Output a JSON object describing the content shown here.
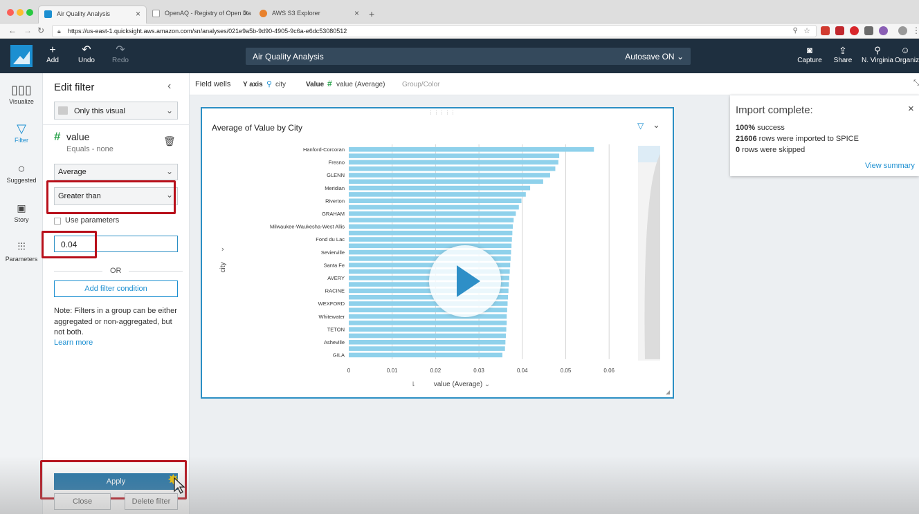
{
  "browser": {
    "tabs": [
      {
        "label": "Air Quality Analysis",
        "active": true
      },
      {
        "label": "OpenAQ - Registry of Open Da",
        "active": false
      },
      {
        "label": "AWS S3 Explorer",
        "active": false
      }
    ],
    "url": "https://us-east-1.quicksight.aws.amazon.com/sn/analyses/021e9a5b-9d90-4905-9c6a-e6dc53080512"
  },
  "header": {
    "add": "Add",
    "undo": "Undo",
    "redo": "Redo",
    "title": "Air Quality Analysis",
    "autosave": "Autosave ON",
    "capture": "Capture",
    "share": "Share",
    "region": "N. Virginia",
    "org": "Organiz"
  },
  "rail": {
    "visualize": "Visualize",
    "filter": "Filter",
    "suggested": "Suggested",
    "story": "Story",
    "parameters": "Parameters"
  },
  "filter_panel": {
    "title": "Edit filter",
    "scope": "Only this visual",
    "field_name": "value",
    "field_desc": "Equals - none",
    "aggregation": "Average",
    "condition": "Greater than",
    "use_parameters": "Use parameters",
    "value": "0.04",
    "or": "OR",
    "add_condition": "Add filter condition",
    "note": "Note: Filters in a group can be either aggregated or non-aggregated, but not both.",
    "learn_more": "Learn more",
    "apply": "Apply",
    "close": "Close",
    "delete": "Delete filter"
  },
  "field_wells": {
    "label": "Field wells",
    "y_axis_label": "Y axis",
    "y_axis_value": "city",
    "value_label": "Value",
    "value_value": "value (Average)",
    "group_label": "Group/Color"
  },
  "toast": {
    "title": "Import complete:",
    "line1_bold": "100%",
    "line1": " success",
    "line2_bold": "21606",
    "line2": " rows were imported to SPICE",
    "line3_bold": "0",
    "line3": " rows were skipped",
    "link": "View summary"
  },
  "colors": {
    "bar": "#8fd1eb",
    "accent": "#1c8fd1",
    "header": "#1e2f3f",
    "highlight": "#b80f1a"
  },
  "chart_data": {
    "type": "bar",
    "orientation": "horizontal",
    "title": "Average of Value by City",
    "xlabel": "value (Average)",
    "ylabel": "city",
    "xlim": [
      0,
      0.06
    ],
    "xticks": [
      "0",
      "0.01",
      "0.02",
      "0.03",
      "0.04",
      "0.05",
      "0.06"
    ],
    "categories": [
      "Hanford-Corcoran",
      "",
      "Fresno",
      "",
      "GLENN",
      "",
      "Meridian",
      "",
      "Riverton",
      "",
      "GRAHAM",
      "",
      "Milwaukee-Waukesha-West Allis",
      "",
      "Fond du Lac",
      "",
      "Sevierville",
      "",
      "Santa Fe",
      "",
      "AVERY",
      "",
      "RACINE",
      "",
      "WEXFORD",
      "",
      "Whitewater",
      "",
      "TETON",
      "",
      "Asheville",
      "",
      "GILA"
    ],
    "values": [
      0.0565,
      0.0485,
      0.0483,
      0.0476,
      0.0464,
      0.0448,
      0.0418,
      0.0408,
      0.0398,
      0.0392,
      0.0385,
      0.038,
      0.0378,
      0.0377,
      0.0376,
      0.0375,
      0.0374,
      0.0373,
      0.0372,
      0.0371,
      0.037,
      0.0369,
      0.0368,
      0.0367,
      0.0366,
      0.0365,
      0.0364,
      0.0364,
      0.0363,
      0.0362,
      0.0361,
      0.036,
      0.0354
    ]
  }
}
